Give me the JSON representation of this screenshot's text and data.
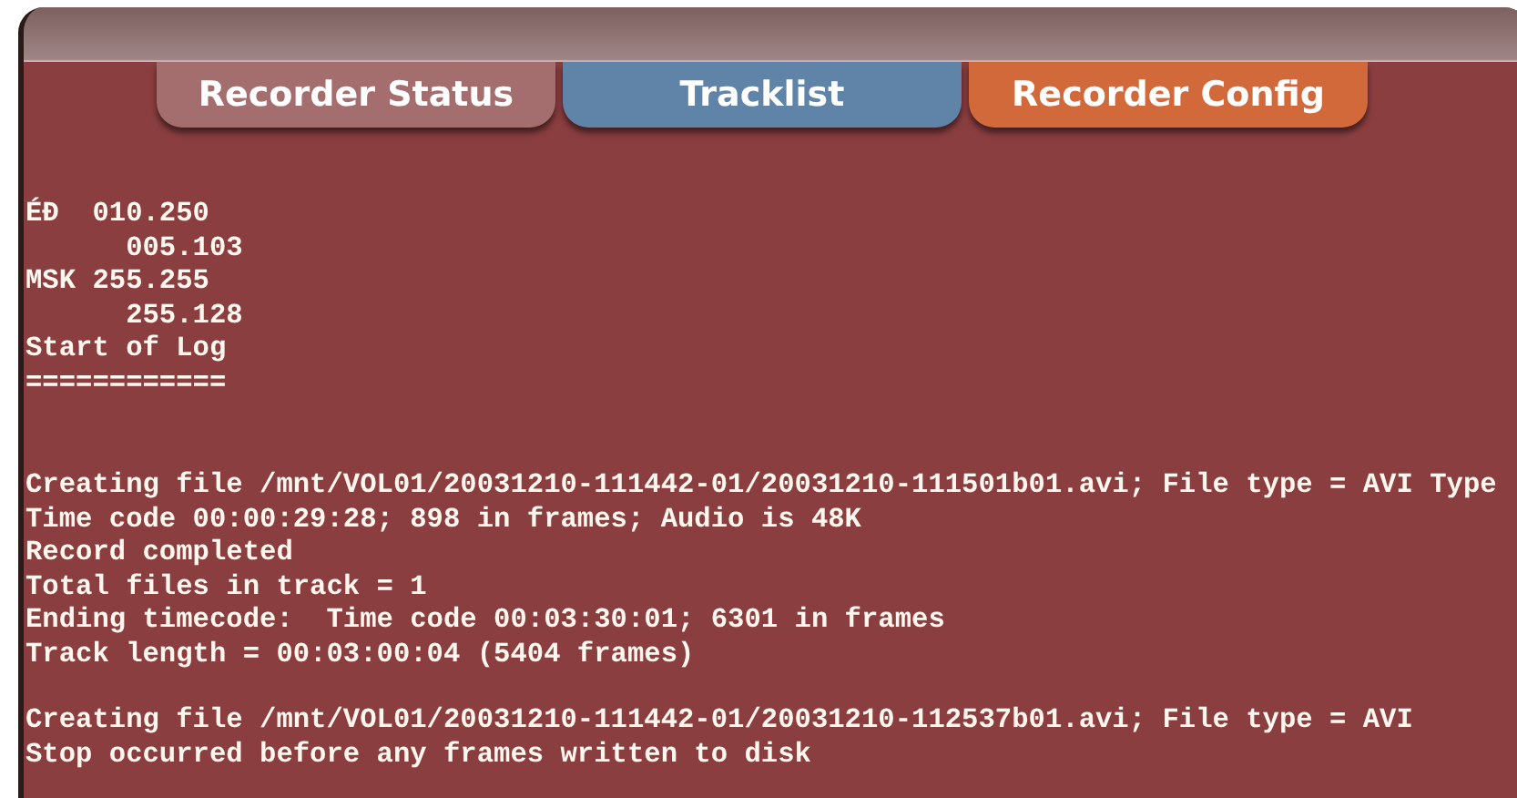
{
  "tabs": [
    {
      "label": "Recorder Status",
      "color": "#a46e6e"
    },
    {
      "label": "Tracklist",
      "color": "#5f84a8"
    },
    {
      "label": "Recorder Config",
      "color": "#d2693a"
    }
  ],
  "log": [
    [
      "ÉĐ  010.250",
      "      005.103",
      "MSK 255.255",
      "      255.128",
      "Start of Log",
      "============"
    ],
    [
      "Creating file /mnt/VOL01/20031210-111442-01/20031210-111501b01.avi; File type = AVI Type",
      "Time code 00:00:29:28; 898 in frames; Audio is 48K",
      "Record completed",
      "Total files in track = 1",
      "Ending timecode:  Time code 00:03:30:01; 6301 in frames",
      "Track length = 00:03:00:04 (5404 frames)"
    ],
    [
      "Creating file /mnt/VOL01/20031210-111442-01/20031210-112537b01.avi; File type = AVI",
      "Stop occurred before any frames written to disk"
    ]
  ]
}
